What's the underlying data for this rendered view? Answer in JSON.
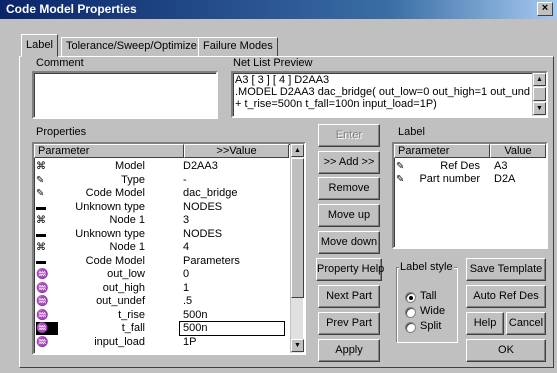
{
  "window": {
    "title": "Code Model Properties",
    "close_glyph": "×"
  },
  "tabs": [
    {
      "label": "Label",
      "active": true
    },
    {
      "label": "Tolerance/Sweep/Optimize",
      "active": false
    },
    {
      "label": "Failure Modes",
      "active": false
    }
  ],
  "comment": {
    "label": "Comment",
    "value": ""
  },
  "netlist": {
    "label": "Net List Preview",
    "lines": [
      "A3 [ 3 ] [ 4 ] D2AA3",
      ".MODEL D2AA3 dac_bridge( out_low=0 out_high=1 out_undef=",
      "+ t_rise=500n t_fall=100n input_load=1P)"
    ]
  },
  "properties": {
    "label": "Properties",
    "col_param": "Parameter",
    "col_value": ">>Value",
    "rows": [
      {
        "icon": "ctx-icon",
        "glyph": "⌘",
        "param": "Model",
        "value": "D2AA3"
      },
      {
        "icon": "pen-icon",
        "glyph": "✎",
        "param": "Type",
        "value": "-"
      },
      {
        "icon": "pen-icon",
        "glyph": "✎",
        "param": "Code Model",
        "value": "dac_bridge"
      },
      {
        "icon": "blank-icon",
        "glyph": "▬",
        "param": "Unknown type",
        "value": "NODES"
      },
      {
        "icon": "ctx-icon",
        "glyph": "⌘",
        "param": "Node 1",
        "value": "3"
      },
      {
        "icon": "blank-icon",
        "glyph": "▬",
        "param": "Unknown type",
        "value": "NODES"
      },
      {
        "icon": "ctx-icon",
        "glyph": "⌘",
        "param": "Node 1",
        "value": "4"
      },
      {
        "icon": "blank-icon",
        "glyph": "▬",
        "param": "Code Model",
        "value": "Parameters"
      },
      {
        "icon": "param-icon",
        "glyph": "♒",
        "param": "out_low",
        "value": "0"
      },
      {
        "icon": "param-icon",
        "glyph": "♒",
        "param": "out_high",
        "value": "1"
      },
      {
        "icon": "param-icon",
        "glyph": "♒",
        "param": "out_undef",
        "value": ".5"
      },
      {
        "icon": "param-icon",
        "glyph": "♒",
        "param": "t_rise",
        "value": "500n"
      },
      {
        "icon": "param-icon",
        "glyph": "♒",
        "param": "t_fall",
        "value": "500n",
        "editing": true
      },
      {
        "icon": "param-icon",
        "glyph": "♒",
        "param": "input_load",
        "value": "1P"
      }
    ]
  },
  "middle_buttons": [
    {
      "name": "enter-button",
      "label": "Enter",
      "disabled": true
    },
    {
      "name": "add-button",
      "label": ">> Add >>"
    },
    {
      "name": "remove-button",
      "label": "Remove"
    },
    {
      "name": "move-up-button",
      "label": "Move up"
    },
    {
      "name": "move-down-button",
      "label": "Move down"
    },
    {
      "name": "property-help-button",
      "label": "Property Help"
    },
    {
      "name": "next-part-button",
      "label": "Next Part"
    },
    {
      "name": "prev-part-button",
      "label": "Prev Part"
    },
    {
      "name": "apply-button",
      "label": "Apply"
    }
  ],
  "label_panel": {
    "label": "Label",
    "col_param": "Parameter",
    "col_value": "Value",
    "rows": [
      {
        "glyph": "✎",
        "param": "Ref Des",
        "value": "A3"
      },
      {
        "glyph": "✎",
        "param": "Part number",
        "value": "D2A"
      }
    ]
  },
  "label_style": {
    "label": "Label style",
    "options": [
      {
        "label": "Tall",
        "selected": true
      },
      {
        "label": "Wide",
        "selected": false
      },
      {
        "label": "Split",
        "selected": false
      }
    ]
  },
  "right_buttons": {
    "save_template": "Save Template",
    "auto_ref_des": "Auto Ref Des",
    "help": "Help",
    "cancel": "Cancel",
    "ok": "OK"
  }
}
